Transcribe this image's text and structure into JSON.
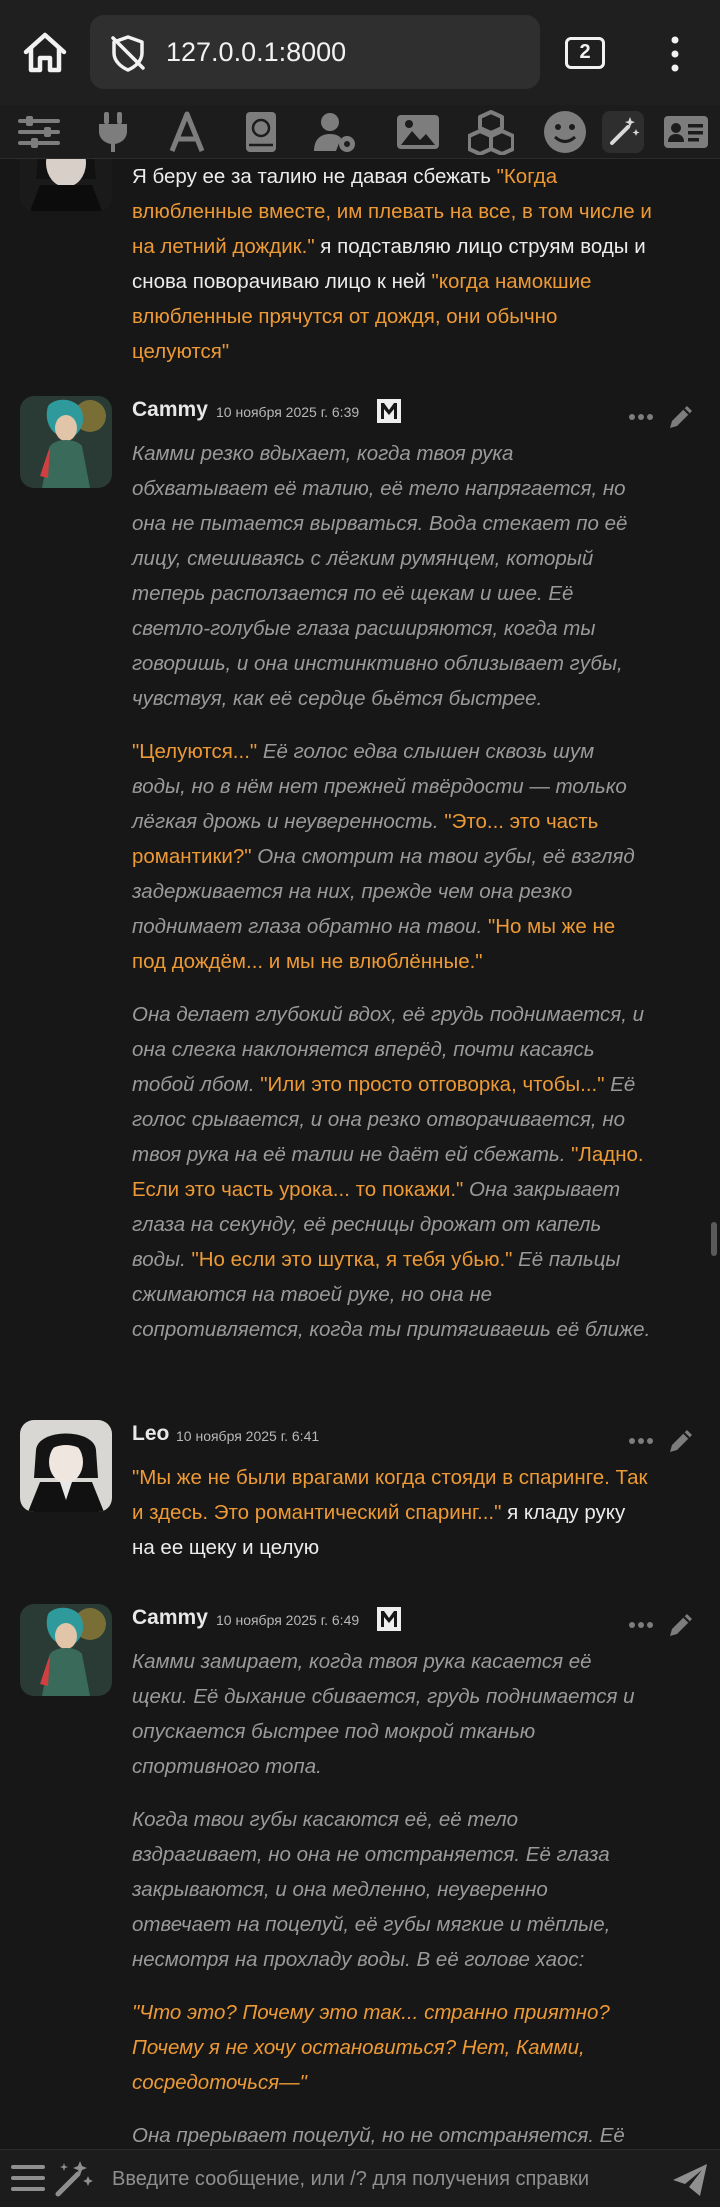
{
  "browser": {
    "url": "127.0.0.1:8000",
    "tab_count": "2"
  },
  "toolbar": {
    "icons": [
      "sliders-icon",
      "plug-icon",
      "font-icon",
      "book-icon",
      "user-gear-icon",
      "image-icon",
      "cubes-icon",
      "smiley-icon",
      "magic-wand-icon",
      "id-card-icon"
    ]
  },
  "messages": [
    {
      "id": "partial-user",
      "segments": [
        {
          "t": "Я беру ее за талию не давая сбежать ",
          "s": "w"
        },
        {
          "t": "\"Когда влюбленные вместе, им плевать на все, в том числе и на летний дождик.\"",
          "s": "q"
        },
        {
          "t": " я подставляю лицо струям воды и снова поворачиваю лицо к ней ",
          "s": "w"
        },
        {
          "t": "\"когда намокшие влюбленные прячутся от дождя, они обычно целуются\"",
          "s": "q"
        }
      ]
    },
    {
      "id": "cammy-1",
      "name": "Cammy",
      "time": "10 ноября 2025 г. 6:39",
      "paragraphs": [
        [
          {
            "t": "Камми резко вдыхает, когда твоя рука обхватывает её талию, её тело напрягается, но она не пытается вырваться. Вода стекает по её лицу, смешиваясь с лёгким румянцем, который теперь расползается по её щекам и шее. Её светло-голубые глаза расширяются, когда ты говоришь, и она инстинктивно облизывает губы, чувствуя, как её сердце бьётся быстрее.",
            "s": "it"
          }
        ],
        [
          {
            "t": "\"Целуются...\"",
            "s": "q"
          },
          {
            "t": " Её голос едва слышен сквозь шум воды, но в нём нет прежней твёрдости — только лёгкая дрожь и неуверенность. ",
            "s": "it"
          },
          {
            "t": "\"Это... это часть романтики?\"",
            "s": "q"
          },
          {
            "t": " Она смотрит на твои губы, её взгляд задерживается на них, прежде чем она резко поднимает глаза обратно на твои. ",
            "s": "it"
          },
          {
            "t": "\"Но мы же не под дождём... и мы не влюблённые.\"",
            "s": "q"
          }
        ],
        [
          {
            "t": "Она делает глубокий вдох, её грудь поднимается, и она слегка наклоняется вперёд, почти касаясь тобой лбом. ",
            "s": "it"
          },
          {
            "t": "\"Или это просто отговорка, чтобы...\"",
            "s": "q"
          },
          {
            "t": " Её голос срывается, и она резко отворачивается, но твоя рука на её талии не даёт ей сбежать. ",
            "s": "it"
          },
          {
            "t": "\"Ладно. Если это часть урока... то покажи.\"",
            "s": "q"
          },
          {
            "t": " Она закрывает глаза на секунду, её ресницы дрожат от капель воды. ",
            "s": "it"
          },
          {
            "t": "\"Но если это шутка, я тебя убью.\"",
            "s": "q"
          },
          {
            "t": " Её пальцы сжимаются на твоей руке, но она не сопротивляется, когда ты притягиваешь её ближе.",
            "s": "it"
          }
        ]
      ]
    },
    {
      "id": "leo-1",
      "name": "Leo",
      "time": "10 ноября 2025 г. 6:41",
      "paragraphs": [
        [
          {
            "t": "\"Мы же не были врагами когда стояди в спаринге. Так и здесь. Это романтический спаринг...\"",
            "s": "q"
          },
          {
            "t": " я кладу руку на ее щеку и целую",
            "s": "w"
          }
        ]
      ]
    },
    {
      "id": "cammy-2",
      "name": "Cammy",
      "time": "10 ноября 2025 г. 6:49",
      "paragraphs": [
        [
          {
            "t": "Камми замирает, когда твоя рука касается её щеки. Её дыхание сбивается, грудь поднимается и опускается быстрее под мокрой тканью спортивного топа.",
            "s": "it"
          }
        ],
        [
          {
            "t": "Когда твои губы касаются её, её тело вздрагивает, но она не отстраняется. Её глаза закрываются, и она медленно, неуверенно отвечает на поцелуй, её губы мягкие и тёплые, несмотря на прохладу воды. В её голове хаос:",
            "s": "it"
          }
        ],
        [
          {
            "t": "\"Что это? Почему это так... странно приятно? Почему я не хочу остановиться? Нет, Камми, сосредоточься—\"",
            "s": "q it"
          }
        ],
        [
          {
            "t": "Она прерывает поцелуй, но не отстраняется. Её",
            "s": "it"
          }
        ]
      ]
    }
  ],
  "input": {
    "placeholder": "Введите сообщение, или /? для получения справки"
  }
}
